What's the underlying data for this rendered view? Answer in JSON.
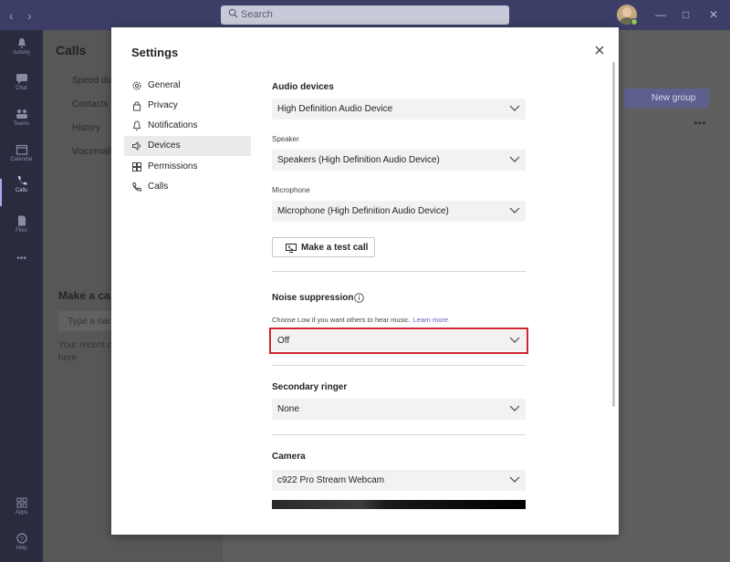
{
  "titlebar": {
    "search_placeholder": "Search",
    "back_icon": "chevron-left-icon",
    "forward_icon": "chevron-right-icon",
    "minimize_icon": "minimize-icon",
    "maximize_icon": "maximize-icon",
    "close_icon": "close-icon",
    "presence_color": "#92c353"
  },
  "rail": {
    "items": [
      {
        "label": "Activity",
        "icon": "bell-icon"
      },
      {
        "label": "Chat",
        "icon": "chat-icon"
      },
      {
        "label": "Teams",
        "icon": "teams-icon"
      },
      {
        "label": "Calendar",
        "icon": "calendar-icon"
      },
      {
        "label": "Calls",
        "icon": "phone-icon"
      },
      {
        "label": "Files",
        "icon": "file-icon"
      },
      {
        "label": "Apps",
        "icon": "apps-icon"
      },
      {
        "label": "Help",
        "icon": "help-icon"
      }
    ],
    "more": "•••"
  },
  "background": {
    "calls_title": "Calls",
    "calls_items": [
      "Speed dia",
      "Contacts",
      "History",
      "Voicemail"
    ],
    "make_call_title": "Make a ca",
    "type_name_placeholder": "Type a nar",
    "recent_text_1": "Your recent c",
    "recent_text_2": "here",
    "new_group_label": "New group",
    "more_options": "•••"
  },
  "modal": {
    "title": "Settings",
    "menu": [
      {
        "label": "General",
        "icon": "gear-icon"
      },
      {
        "label": "Privacy",
        "icon": "lock-icon"
      },
      {
        "label": "Notifications",
        "icon": "bell-icon"
      },
      {
        "label": "Devices",
        "icon": "speaker-icon"
      },
      {
        "label": "Permissions",
        "icon": "grid-icon"
      },
      {
        "label": "Calls",
        "icon": "phone-icon"
      }
    ],
    "selected_menu": "Devices",
    "audio_devices": {
      "title": "Audio devices",
      "value": "High Definition Audio Device"
    },
    "speaker": {
      "label": "Speaker",
      "value": "Speakers (High Definition Audio Device)"
    },
    "microphone": {
      "label": "Microphone",
      "value": "Microphone (High Definition Audio Device)"
    },
    "test_call_label": "Make a test call",
    "noise_suppression": {
      "title": "Noise suppression",
      "hint": "Choose Low if you want others to hear music.",
      "learn_more": "Learn more.",
      "value": "Off",
      "highlight_color": "#d0252f"
    },
    "secondary_ringer": {
      "title": "Secondary ringer",
      "value": "None"
    },
    "camera": {
      "title": "Camera",
      "value": "c922 Pro Stream Webcam"
    }
  }
}
